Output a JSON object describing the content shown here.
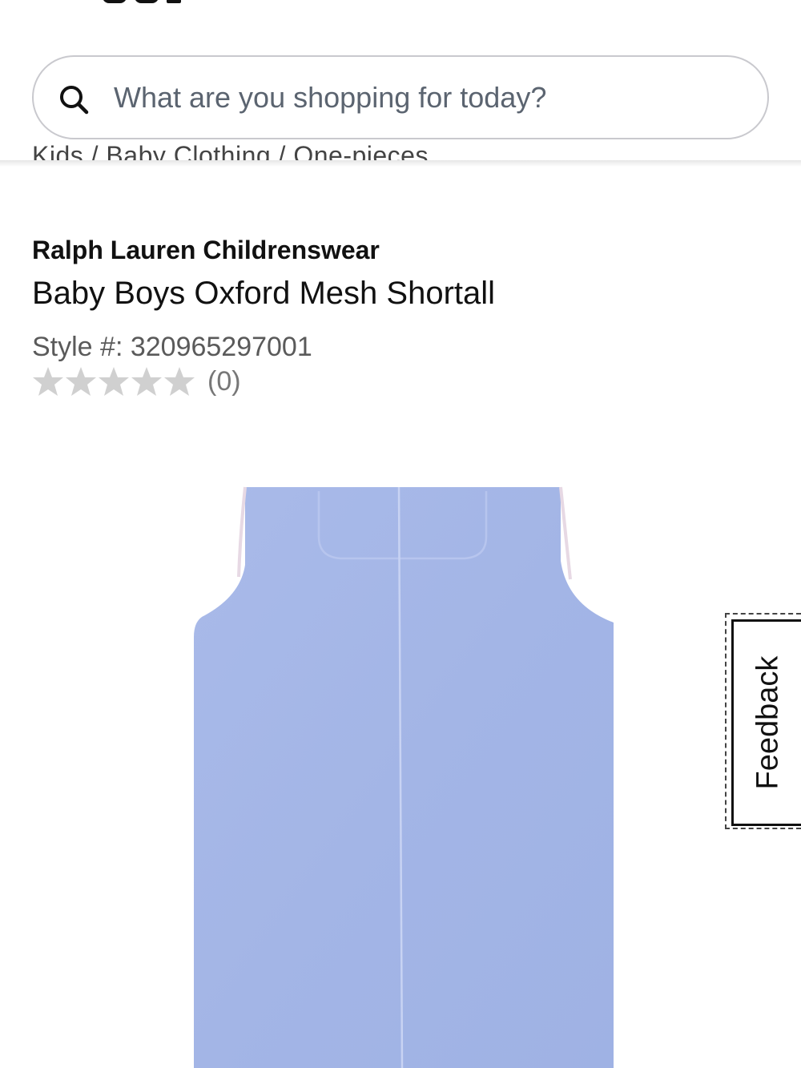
{
  "header": {
    "search": {
      "placeholder": "What are you shopping for today?",
      "value": "",
      "icon": "search-icon"
    }
  },
  "breadcrumb": {
    "text": "Kids / Baby Clothing / One-pieces"
  },
  "product": {
    "brand": "Ralph Lauren Childrenswear",
    "title": "Baby Boys Oxford Mesh Shortall",
    "style_label": "Style #: 320965297001",
    "rating": {
      "stars_filled": 0,
      "stars_total": 5,
      "count_label": "(0)"
    },
    "image": {
      "subject": "shortall-image",
      "color": "#a3b5e6"
    }
  },
  "feedback": {
    "label": "Feedback"
  },
  "colors": {
    "search_border": "#c9c9ce",
    "placeholder_text": "#5b6470",
    "star_empty": "#d0d0d0"
  }
}
